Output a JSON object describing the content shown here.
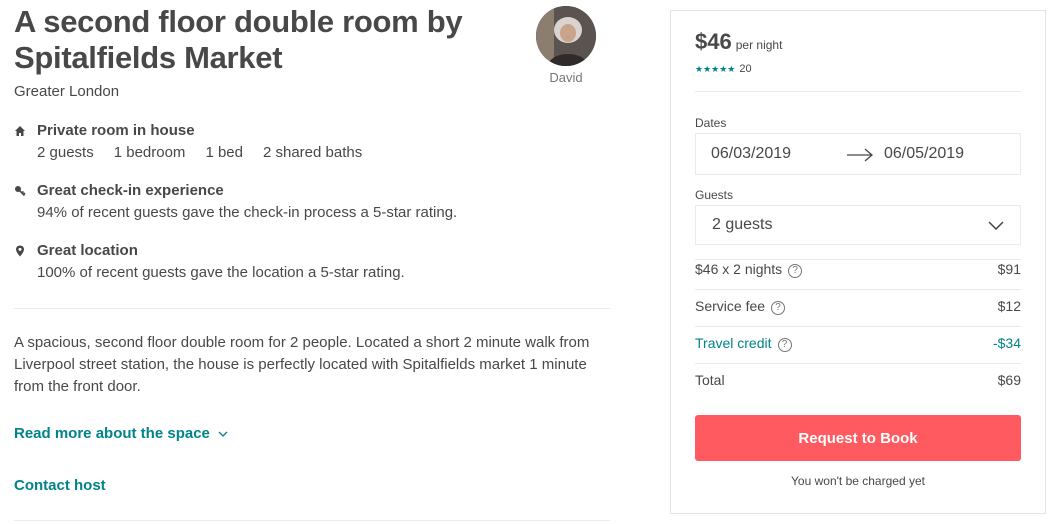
{
  "listing": {
    "title": "A second floor double room by Spitalfields Market",
    "location": "Greater London",
    "host_name": "David"
  },
  "features": [
    {
      "icon": "house-icon",
      "title": "Private room in house",
      "stats": [
        "2 guests",
        "1 bedroom",
        "1 bed",
        "2 shared baths"
      ]
    },
    {
      "icon": "key-icon",
      "title": "Great check-in experience",
      "text": "94% of recent guests gave the check-in process a 5-star rating."
    },
    {
      "icon": "map-pin-icon",
      "title": "Great location",
      "text": "100% of recent guests gave the location a 5-star rating."
    }
  ],
  "description": "A spacious, second floor double room for 2 people. Located a short 2 minute walk from Liverpool street station, the house is perfectly located with Spitalfields market 1 minute from the front door.",
  "links": {
    "read_more": "Read more about the space",
    "contact_host": "Contact host"
  },
  "booking": {
    "price": "$46",
    "per_night": "per night",
    "stars": "★★★★★",
    "rating_stars": 5,
    "review_count": "20",
    "dates_label": "Dates",
    "check_in": "06/03/2019",
    "check_out": "06/05/2019",
    "guests_label": "Guests",
    "guests_value": "2 guests",
    "lines": [
      {
        "label": "$46 x 2 nights",
        "amount": "$91",
        "help": true
      },
      {
        "label": "Service fee",
        "amount": "$12",
        "help": true
      },
      {
        "label": "Travel credit",
        "amount": "-$34",
        "help": true,
        "accent": true
      },
      {
        "label": "Total",
        "amount": "$69",
        "help": false
      }
    ],
    "help_glyph": "?",
    "button_label": "Request to Book",
    "note": "You won't be charged yet"
  },
  "colors": {
    "accent": "#008489",
    "brand": "#ff5a5f",
    "text": "#484848"
  }
}
